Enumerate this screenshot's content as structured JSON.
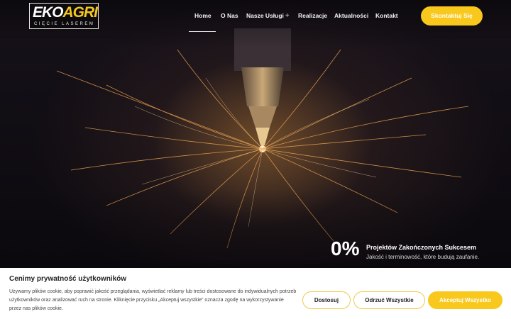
{
  "logo": {
    "main_left": "EKO",
    "main_right": "AGRI",
    "sub": "CIĘCIE LASEREM"
  },
  "nav": {
    "items": [
      {
        "label": "Home",
        "active": true
      },
      {
        "label": "O Nas"
      },
      {
        "label": "Nasze Usługi",
        "has_submenu": true
      },
      {
        "label": "Realizacje"
      },
      {
        "label": "Aktualności"
      },
      {
        "label": "Kontakt"
      }
    ],
    "submenu_icon": "+",
    "cta_label": "Skontaktuj Się"
  },
  "hero": {
    "image": "laser-cutting-sparks"
  },
  "stat": {
    "number": "0%",
    "title": "Projektów Zakończonych Sukcesem",
    "description": "Jakość i terminowość, które budują zaufanie."
  },
  "cookie": {
    "title": "Cenimy prywatność użytkowników",
    "text": "Używamy plików cookie, aby poprawić jakość przeglądania, wyświetlać reklamy lub treści dostosowane do indywidualnych potrzeb użytkowników oraz analizować ruch na stronie. Kliknięcie przycisku „Akceptuj wszystkie” oznacza zgodę na wykorzystywanie przez nas plików cookie.",
    "customize_label": "Dostosuj",
    "reject_label": "Odrzuć Wszystkie",
    "accept_label": "Akceptuj Wszystko"
  },
  "colors": {
    "accent": "#f8c81c",
    "dark": "#0e0b10",
    "white": "#ffffff"
  }
}
